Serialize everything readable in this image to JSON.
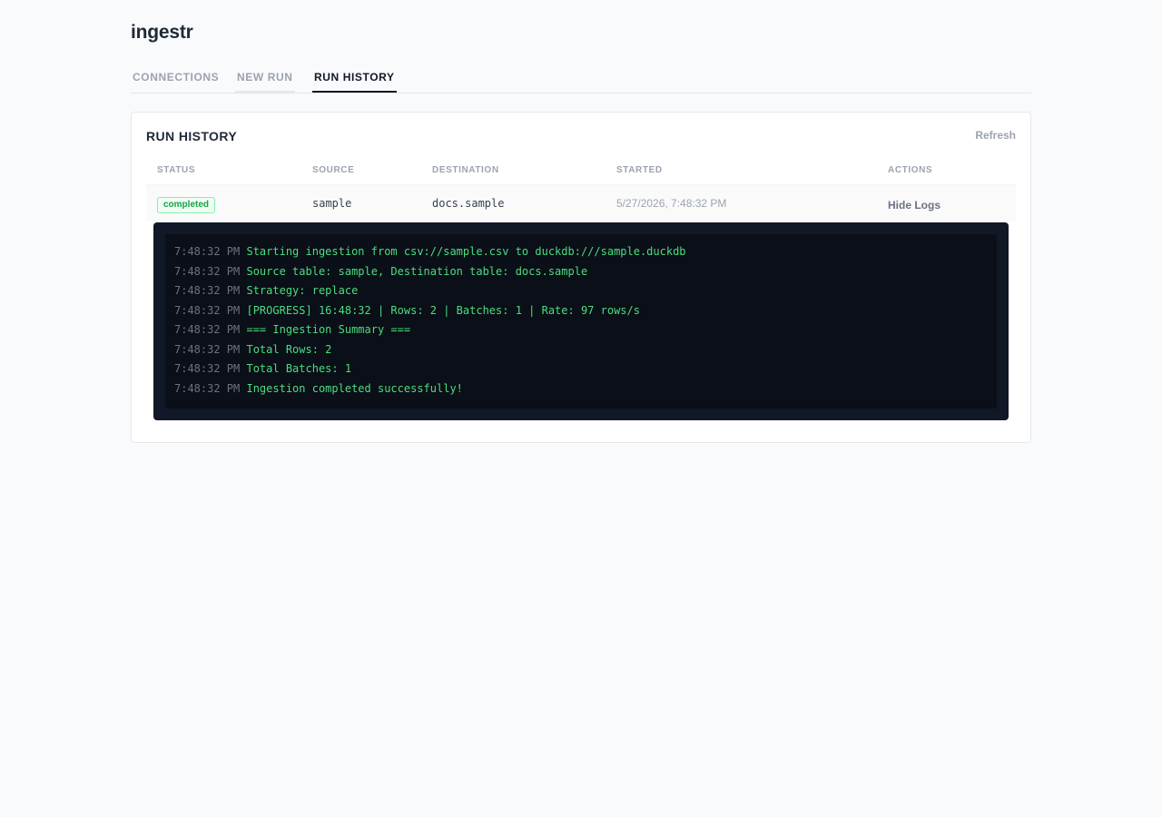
{
  "app": {
    "title": "ingestr"
  },
  "tabs": [
    {
      "label": "CONNECTIONS",
      "state": "inactive"
    },
    {
      "label": "NEW RUN",
      "state": "visited"
    },
    {
      "label": "RUN HISTORY",
      "state": "active"
    }
  ],
  "run_history": {
    "title": "RUN HISTORY",
    "refresh_label": "Refresh",
    "columns": [
      "STATUS",
      "SOURCE",
      "DESTINATION",
      "STARTED",
      "ACTIONS"
    ],
    "rows": [
      {
        "status": "completed",
        "source": "sample",
        "destination": "docs.sample",
        "started": "5/27/2026, 7:48:32 PM",
        "action_label": "Hide Logs"
      }
    ],
    "logs": [
      {
        "time": "7:48:32 PM",
        "message": "Starting ingestion from csv://sample.csv to duckdb:///sample.duckdb"
      },
      {
        "time": "7:48:32 PM",
        "message": "Source table: sample, Destination table: docs.sample"
      },
      {
        "time": "7:48:32 PM",
        "message": "Strategy: replace"
      },
      {
        "time": "7:48:32 PM",
        "message": "[PROGRESS] 16:48:32 | Rows: 2 | Batches: 1 | Rate: 97 rows/s"
      },
      {
        "time": "7:48:32 PM",
        "message": "=== Ingestion Summary ==="
      },
      {
        "time": "7:48:32 PM",
        "message": "Total Rows: 2"
      },
      {
        "time": "7:48:32 PM",
        "message": "Total Batches: 1"
      },
      {
        "time": "7:48:32 PM",
        "message": "Ingestion completed successfully!"
      }
    ]
  },
  "colors": {
    "accent": "#111827",
    "status_completed": "#16a34a",
    "log_text": "#4ade80",
    "log_background": "#111827"
  }
}
